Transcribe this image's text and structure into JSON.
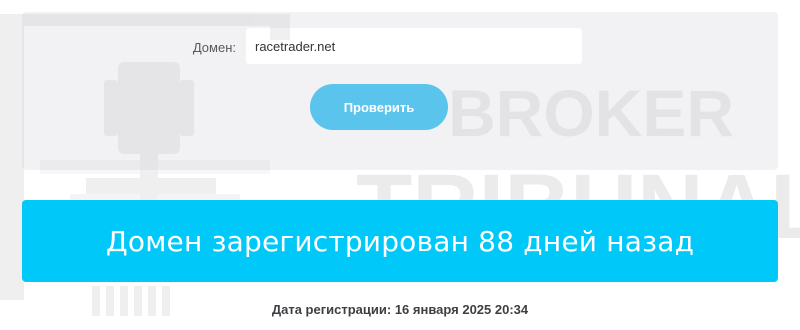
{
  "form": {
    "domain_label": "Домен:",
    "domain_value": "racetrader.net",
    "check_button_label": "Проверить"
  },
  "result": {
    "message": "Домен зарегистрирован 88 дней назад"
  },
  "registration": {
    "text": "Дата регистрации: 16 января 2025 20:34"
  },
  "watermark": {
    "line1": "BROKER",
    "line2": "TRIBUNAL"
  },
  "colors": {
    "panel_bg": "#f2f2f4",
    "button": "#5bc4ec",
    "banner": "#00c9fa",
    "watermark": "#d7d8da"
  }
}
